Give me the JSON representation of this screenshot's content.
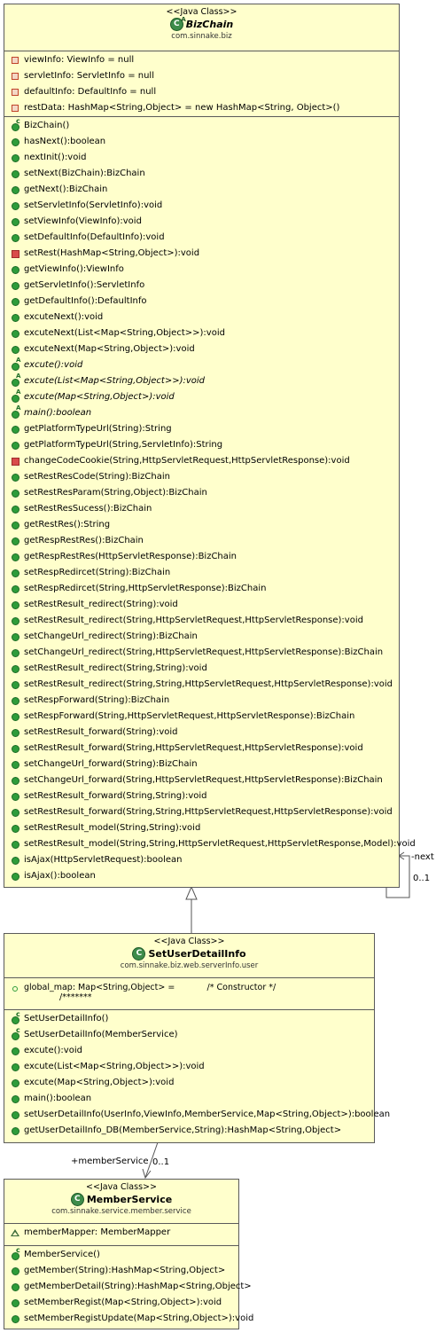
{
  "classes": {
    "bizchain": {
      "stereotype": "<<Java Class>>",
      "name": "BizChain",
      "package": "com.sinnake.biz",
      "fields": [
        {
          "icon": "private",
          "text": "viewInfo: ViewInfo = null"
        },
        {
          "icon": "private",
          "text": "servletInfo: ServletInfo = null"
        },
        {
          "icon": "private",
          "text": "defaultInfo: DefaultInfo = null"
        },
        {
          "icon": "private",
          "text": "restData: HashMap<String,Object> = new HashMap<String, Object>()"
        }
      ],
      "methods": [
        {
          "icon": "constructor",
          "text": "BizChain()"
        },
        {
          "icon": "public",
          "text": "hasNext():boolean"
        },
        {
          "icon": "public",
          "text": "nextInit():void"
        },
        {
          "icon": "public",
          "text": "setNext(BizChain):BizChain"
        },
        {
          "icon": "public",
          "text": "getNext():BizChain"
        },
        {
          "icon": "public",
          "text": "setServletInfo(ServletInfo):void"
        },
        {
          "icon": "public",
          "text": "setViewInfo(ViewInfo):void"
        },
        {
          "icon": "public",
          "text": "setDefaultInfo(DefaultInfo):void"
        },
        {
          "icon": "private",
          "text": "setRest(HashMap<String,Object>):void"
        },
        {
          "icon": "public",
          "text": "getViewInfo():ViewInfo"
        },
        {
          "icon": "public",
          "text": "getServletInfo():ServletInfo"
        },
        {
          "icon": "public",
          "text": "getDefaultInfo():DefaultInfo"
        },
        {
          "icon": "public",
          "text": "excuteNext():void"
        },
        {
          "icon": "public",
          "text": "excuteNext(List<Map<String,Object>>):void"
        },
        {
          "icon": "public",
          "text": "excuteNext(Map<String,Object>):void"
        },
        {
          "icon": "abstract",
          "text": "excute():void"
        },
        {
          "icon": "abstract",
          "text": "excute(List<Map<String,Object>>):void"
        },
        {
          "icon": "abstract",
          "text": "excute(Map<String,Object>):void"
        },
        {
          "icon": "abstract",
          "text": "main():boolean"
        },
        {
          "icon": "public",
          "text": "getPlatformTypeUrl(String):String"
        },
        {
          "icon": "public",
          "text": "getPlatformTypeUrl(String,ServletInfo):String"
        },
        {
          "icon": "private",
          "text": "changeCodeCookie(String,HttpServletRequest,HttpServletResponse):void"
        },
        {
          "icon": "public",
          "text": "setRestResCode(String):BizChain"
        },
        {
          "icon": "public",
          "text": "setRestResParam(String,Object):BizChain"
        },
        {
          "icon": "public",
          "text": "setRestResSucess():BizChain"
        },
        {
          "icon": "public",
          "text": "getRestRes():String"
        },
        {
          "icon": "public",
          "text": "getRespRestRes():BizChain"
        },
        {
          "icon": "public",
          "text": "getRespRestRes(HttpServletResponse):BizChain"
        },
        {
          "icon": "public",
          "text": "setRespRedircet(String):BizChain"
        },
        {
          "icon": "public",
          "text": "setRespRedircet(String,HttpServletResponse):BizChain"
        },
        {
          "icon": "public",
          "text": "setRestResult_redirect(String):void"
        },
        {
          "icon": "public",
          "text": "setRestResult_redirect(String,HttpServletRequest,HttpServletResponse):void"
        },
        {
          "icon": "public",
          "text": "setChangeUrl_redirect(String):BizChain"
        },
        {
          "icon": "public",
          "text": "setChangeUrl_redirect(String,HttpServletRequest,HttpServletResponse):BizChain"
        },
        {
          "icon": "public",
          "text": "setRestResult_redirect(String,String):void"
        },
        {
          "icon": "public",
          "text": "setRestResult_redirect(String,String,HttpServletRequest,HttpServletResponse):void"
        },
        {
          "icon": "public",
          "text": "setRespForward(String):BizChain"
        },
        {
          "icon": "public",
          "text": "setRespForward(String,HttpServletRequest,HttpServletResponse):BizChain"
        },
        {
          "icon": "public",
          "text": "setRestResult_forward(String):void"
        },
        {
          "icon": "public",
          "text": "setRestResult_forward(String,HttpServletRequest,HttpServletResponse):void"
        },
        {
          "icon": "public",
          "text": "setChangeUrl_forward(String):BizChain"
        },
        {
          "icon": "public",
          "text": "setChangeUrl_forward(String,HttpServletRequest,HttpServletResponse):BizChain"
        },
        {
          "icon": "public",
          "text": "setRestResult_forward(String,String):void"
        },
        {
          "icon": "public",
          "text": "setRestResult_forward(String,String,HttpServletRequest,HttpServletResponse):void"
        },
        {
          "icon": "public",
          "text": "setRestResult_model(String,String):void"
        },
        {
          "icon": "public",
          "text": "setRestResult_model(String,String,HttpServletRequest,HttpServletResponse,Model):void"
        },
        {
          "icon": "public",
          "text": "isAjax(HttpServletRequest):boolean"
        },
        {
          "icon": "public",
          "text": "isAjax():boolean"
        }
      ]
    },
    "setuserdetailinfo": {
      "stereotype": "<<Java Class>>",
      "name": "SetUserDetailInfo",
      "package": "com.sinnake.biz.web.serverInfo.user",
      "field_line1": "global_map: Map<String,Object> =            /* Constructor */",
      "field_line2": "/*******",
      "methods": [
        {
          "icon": "constructor",
          "text": "SetUserDetailInfo()"
        },
        {
          "icon": "constructor",
          "text": "SetUserDetailInfo(MemberService)"
        },
        {
          "icon": "public",
          "text": "excute():void"
        },
        {
          "icon": "public",
          "text": "excute(List<Map<String,Object>>):void"
        },
        {
          "icon": "public",
          "text": "excute(Map<String,Object>):void"
        },
        {
          "icon": "public",
          "text": "main():boolean"
        },
        {
          "icon": "public",
          "text": "setUserDetailInfo(UserInfo,ViewInfo,MemberService,Map<String,Object>):boolean"
        },
        {
          "icon": "public",
          "text": "getUserDetailInfo_DB(MemberService,String):HashMap<String,Object>"
        }
      ]
    },
    "memberservice": {
      "stereotype": "<<Java Class>>",
      "name": "MemberService",
      "package": "com.sinnake.service.member.service",
      "fields": [
        {
          "icon": "package",
          "text": "memberMapper: MemberMapper"
        }
      ],
      "methods": [
        {
          "icon": "constructor",
          "text": "MemberService()"
        },
        {
          "icon": "public",
          "text": "getMember(String):HashMap<String,Object>"
        },
        {
          "icon": "public",
          "text": "getMemberDetail(String):HashMap<String,Object>"
        },
        {
          "icon": "public",
          "text": "setMemberRegist(Map<String,Object>):void"
        },
        {
          "icon": "public",
          "text": "setMemberRegistUpdate(Map<String,Object>):void"
        }
      ]
    }
  },
  "relations": {
    "self_next_role": "-next",
    "self_next_mult": "0..1",
    "member_role": "+memberService",
    "member_mult": "0..1"
  },
  "colors": {
    "box_fill": "#ffffcc",
    "border": "#5a5a5a",
    "public_icon": "#2e9c3a",
    "private_icon": "#d94b4b"
  }
}
